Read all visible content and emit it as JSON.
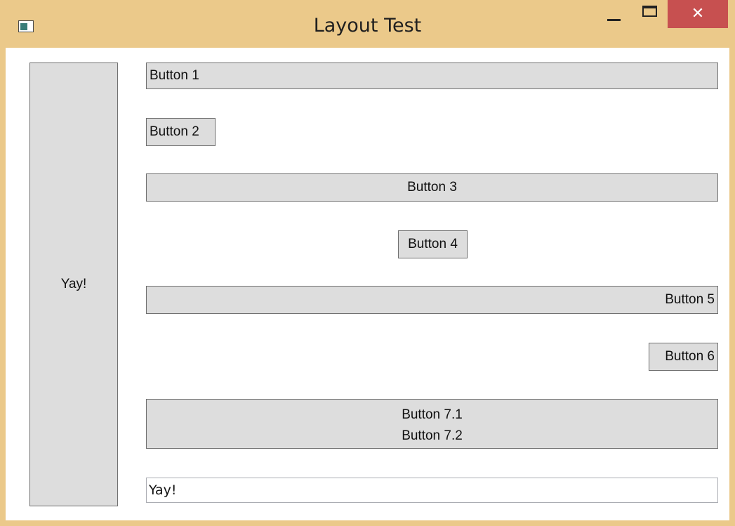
{
  "window": {
    "title": "Layout Test",
    "icon": "window-app-icon",
    "controls": {
      "minimize_icon": "minimize-icon",
      "maximize_icon": "maximize-icon",
      "close_glyph": "✕",
      "close_color": "#C75050"
    },
    "frame_color": "#EBC98A"
  },
  "left_panel": {
    "button_label": "Yay!"
  },
  "buttons": {
    "b1": "Button 1",
    "b2": "Button 2",
    "b3": "Button 3",
    "b4": "Button 4",
    "b5": "Button 5",
    "b6": "Button 6",
    "b7_line1": "Button 7.1",
    "b7_line2": "Button 7.2"
  },
  "text_input": {
    "value": "Yay!"
  },
  "colors": {
    "button_face": "#DDDDDD",
    "button_border": "#707070"
  }
}
